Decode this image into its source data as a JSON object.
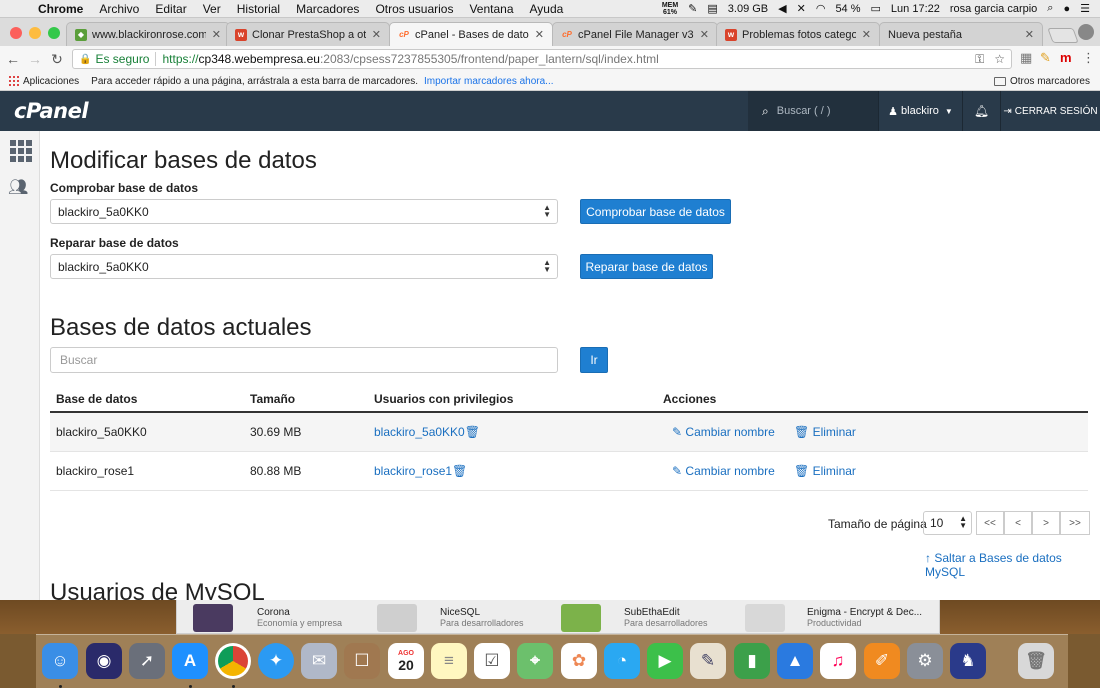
{
  "menubar": {
    "app": "Chrome",
    "items": [
      "Archivo",
      "Editar",
      "Ver",
      "Historial",
      "Marcadores",
      "Otros usuarios",
      "Ventana",
      "Ayuda"
    ],
    "mem_top": "MEM",
    "mem_bottom": "61%",
    "storage": "3.09 GB",
    "battery": "54 %",
    "clock": "Lun 17:22",
    "user": "rosa garcia carpio"
  },
  "tabs": [
    {
      "title": "www.blackironrose.com/adm",
      "color": "#5a9e3a",
      "glyph": "w"
    },
    {
      "title": "Clonar PrestaShop a otra cu",
      "color": "#d9432b",
      "glyph": "w"
    },
    {
      "title": "cPanel - Bases de datos de M",
      "color": "#ff6c2c",
      "glyph": "cP",
      "active": true
    },
    {
      "title": "cPanel File Manager v3",
      "color": "#ff6c2c",
      "glyph": "cP"
    },
    {
      "title": "Problemas fotos categorías",
      "color": "#d9432b",
      "glyph": "w"
    },
    {
      "title": "Nueva pestaña",
      "color": "",
      "glyph": ""
    }
  ],
  "address": {
    "secure_label": "Es seguro",
    "protocol": "https://",
    "host": "cp348.webempresa.eu",
    "path": ":2083/cpsess7237855305/frontend/paper_lantern/sql/index.html"
  },
  "bookmarks": {
    "apps": "Aplicaciones",
    "hint": "Para acceder rápido a una página, arrástrala a esta barra de marcadores.",
    "import": "Importar marcadores ahora...",
    "other": "Otros marcadores"
  },
  "cpanel": {
    "logo": "cPanel",
    "search_placeholder": "Buscar ( / )",
    "user": "blackiro",
    "logout": "CERRAR SESIÓN"
  },
  "page": {
    "title": "Modificar bases de datos",
    "check_label": "Comprobar base de datos",
    "check_value": "blackiro_5a0KK0",
    "check_button": "Comprobar base de datos",
    "repair_label": "Reparar base de datos",
    "repair_value": "blackiro_5a0KK0",
    "repair_button": "Reparar base de datos",
    "current_title": "Bases de datos actuales",
    "search_placeholder": "Buscar",
    "go_button": "Ir",
    "columns": [
      "Base de datos",
      "Tamaño",
      "Usuarios con privilegios",
      "Acciones"
    ],
    "rows": [
      {
        "db": "blackiro_5a0KK0",
        "size": "30.69 MB",
        "user": "blackiro_5a0KK0",
        "rename": "Cambiar nombre",
        "delete": "Eliminar"
      },
      {
        "db": "blackiro_rose1",
        "size": "80.88 MB",
        "user": "blackiro_rose1",
        "rename": "Cambiar nombre",
        "delete": "Eliminar"
      }
    ],
    "page_size_label": "Tamaño de página",
    "page_size": "10",
    "pager": [
      "<<",
      "<",
      ">",
      ">>"
    ],
    "jump_link": "Saltar a Bases de datos MySQL",
    "next_section": "Usuarios de MySQL"
  },
  "store": [
    {
      "name": "Corona",
      "category": "Economía y empresa"
    },
    {
      "name": "NiceSQL",
      "category": "Para desarrolladores"
    },
    {
      "name": "SubEthaEdit",
      "category": "Para desarrolladores"
    },
    {
      "name": "Enigma - Encrypt & Dec...",
      "category": "Productividad"
    }
  ],
  "dock": {
    "calendar_month": "AGO",
    "calendar_day": "20"
  }
}
